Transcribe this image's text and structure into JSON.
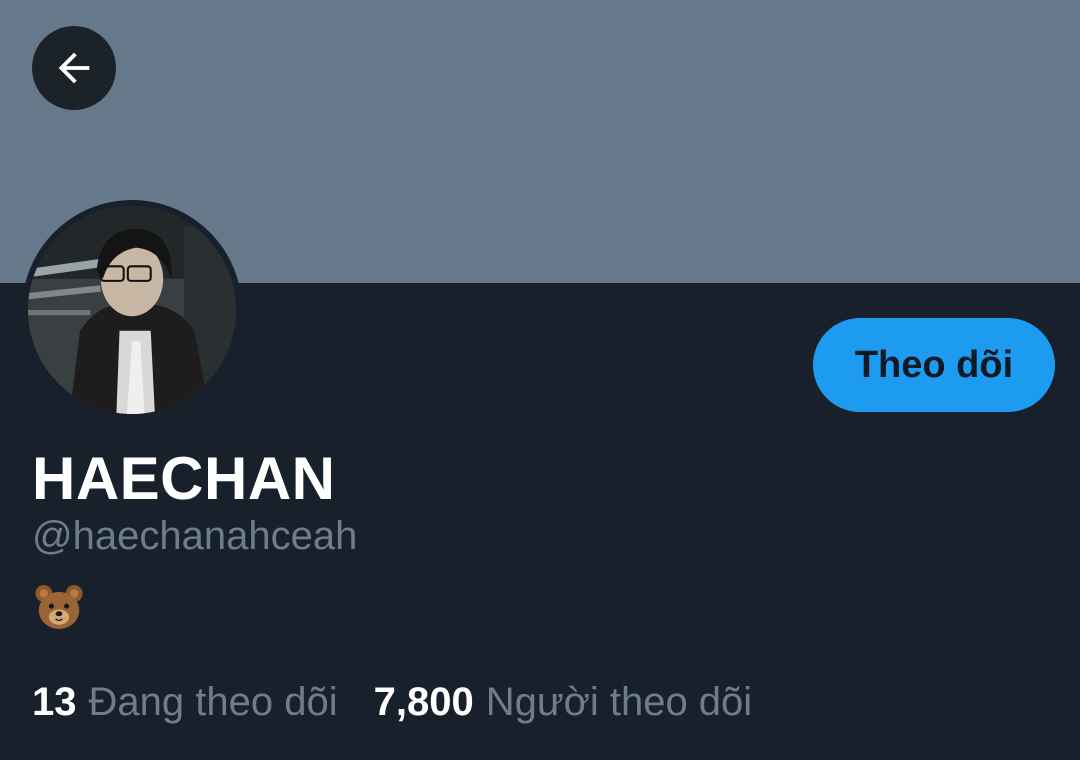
{
  "profile": {
    "display_name": "HAECHAN",
    "handle": "@haechanahceah",
    "bio_icon": "bear-face-emoji",
    "follow_button_label": "Theo dõi"
  },
  "navigation": {
    "back_icon": "arrow-left-icon"
  },
  "stats": {
    "following_count": "13",
    "following_label": "Đang theo dõi",
    "followers_count": "7,800",
    "followers_label": "Người theo dõi"
  },
  "colors": {
    "banner": "#66798b",
    "background": "#18202b",
    "accent": "#1d9bf0",
    "secondary_text": "#6e7d8c",
    "primary_text": "#ffffff"
  }
}
